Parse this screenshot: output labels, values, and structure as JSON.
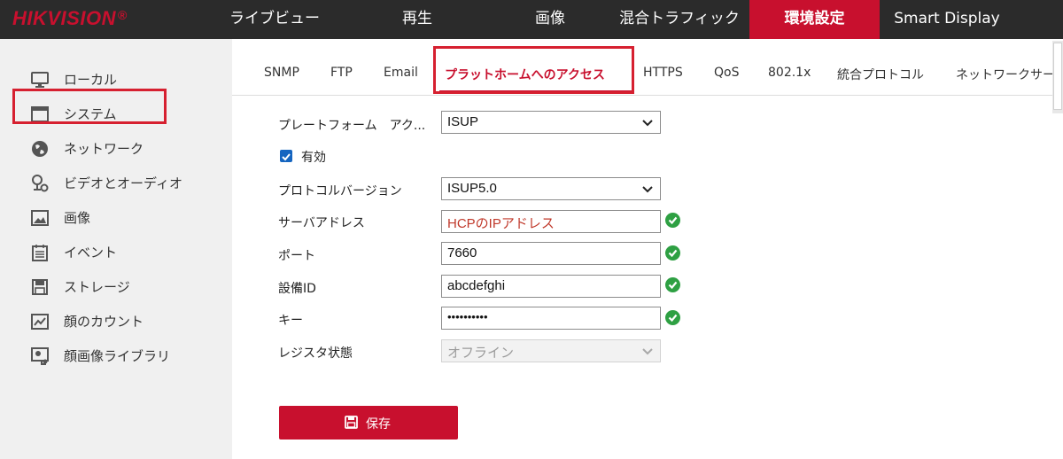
{
  "brand": {
    "name": "HIKVISION",
    "reg": "®"
  },
  "nav": {
    "items": [
      "ライブビュー",
      "再生",
      "画像",
      "混合トラフィック",
      "環境設定",
      "Smart Display"
    ],
    "active": "環境設定"
  },
  "sidebar": {
    "items": [
      {
        "label": "ローカル",
        "icon": "monitor-icon"
      },
      {
        "label": "システム",
        "icon": "system-icon"
      },
      {
        "label": "ネットワーク",
        "icon": "globe-icon"
      },
      {
        "label": "ビデオとオーディオ",
        "icon": "video-audio-icon"
      },
      {
        "label": "画像",
        "icon": "image-icon"
      },
      {
        "label": "イベント",
        "icon": "event-icon"
      },
      {
        "label": "ストレージ",
        "icon": "storage-icon"
      },
      {
        "label": "顔のカウント",
        "icon": "face-count-icon"
      },
      {
        "label": "顔画像ライブラリ",
        "icon": "face-library-icon"
      }
    ],
    "selected": "ネットワーク"
  },
  "tabs": {
    "items": [
      "SNMP",
      "FTP",
      "Email",
      "プラットホームへのアクセス",
      "HTTPS",
      "QoS",
      "802.1x",
      "統合プロトコル",
      "ネットワークサー"
    ],
    "active": "プラットホームへのアクセス"
  },
  "form": {
    "platform_access_label": "プレートフォーム　アク...",
    "platform_access_value": "ISUP",
    "enabled_label": "有効",
    "enabled": true,
    "protocol_version_label": "プロトコルバージョン",
    "protocol_version_value": "ISUP5.0",
    "server_address_label": "サーバアドレス",
    "server_address_value": "HCPのIPアドレス",
    "port_label": "ポート",
    "port_value": "7660",
    "device_id_label": "設備ID",
    "device_id_value": "abcdefghi",
    "key_label": "キー",
    "key_value": "••••••••••",
    "register_status_label": "レジスタ状態",
    "register_status_value": "オフライン"
  },
  "actions": {
    "save_label": "保存"
  },
  "colors": {
    "brand_red": "#c8102e",
    "topbar": "#2b2b2b",
    "sidebar": "#f0f0f0",
    "ok_green": "#2ea043",
    "highlight": "#d62030",
    "checkbox": "#1565c0"
  }
}
